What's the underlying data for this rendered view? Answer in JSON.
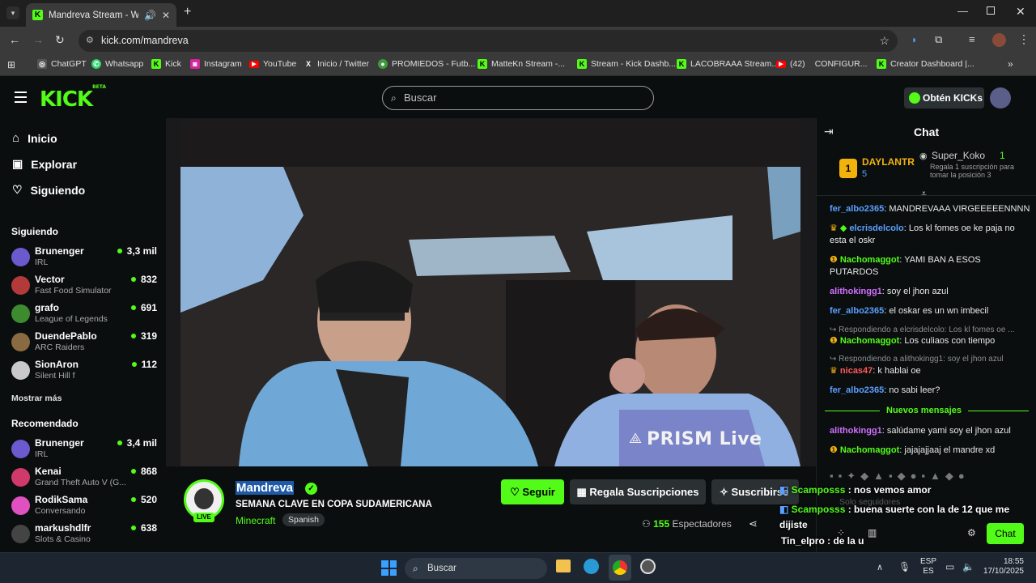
{
  "browser": {
    "tab_title": "Mandreva Stream - Watch",
    "url": "kick.com/mandreva",
    "bookmarks": [
      "ChatGPT",
      "Whatsapp",
      "Kick",
      "Instagram",
      "YouTube",
      "Inicio / Twitter",
      "PROMIEDOS - Futb...",
      "MatteKn Stream -...",
      "Stream - Kick Dashb...",
      "LACOBRAAA Stream...",
      "(42)",
      "CONFIGUR...",
      "Creator Dashboard |..."
    ]
  },
  "header": {
    "logo": "KICK",
    "logo_beta": "BETA",
    "search_placeholder": "Buscar",
    "get_kicks": "Obtén KICKs"
  },
  "sidebar": {
    "nav": [
      "Inicio",
      "Explorar",
      "Siguiendo"
    ],
    "following_title": "Siguiendo",
    "following": [
      {
        "name": "Brunenger",
        "category": "IRL",
        "viewers": "3,3 mil",
        "color": "#6a5acd"
      },
      {
        "name": "Vector",
        "category": "Fast Food Simulator",
        "viewers": "832",
        "color": "#b33a3a"
      },
      {
        "name": "grafo",
        "category": "League of Legends",
        "viewers": "691",
        "color": "#3d8b2f"
      },
      {
        "name": "DuendePablo",
        "category": "ARC Raiders",
        "viewers": "319",
        "color": "#8a6a40"
      },
      {
        "name": "SionAron",
        "category": "Silent Hill f",
        "viewers": "112",
        "color": "#c9c9c9"
      }
    ],
    "show_more": "Mostrar más",
    "recommended_title": "Recomendado",
    "recommended": [
      {
        "name": "Brunenger",
        "category": "IRL",
        "viewers": "3,4 mil",
        "color": "#6a5acd"
      },
      {
        "name": "Kenai",
        "category": "Grand Theft Auto V (G...",
        "viewers": "868",
        "color": "#d03a6a"
      },
      {
        "name": "RodikSama",
        "category": "Conversando",
        "viewers": "520",
        "color": "#e050c0"
      },
      {
        "name": "markushdlfr",
        "category": "Slots & Casino",
        "viewers": "638",
        "color": "#444"
      }
    ]
  },
  "video": {
    "watermark": "PRISM Live"
  },
  "stream": {
    "channel": "Mandreva",
    "title": "SEMANA CLAVE EN COPA SUDAMERICANA",
    "category": "Minecraft",
    "language": "Spanish",
    "live": "LIVE",
    "follow": "Seguir",
    "gift_subs": "Regala Suscripciones",
    "subscribe": "Suscribirse",
    "viewers": "155",
    "viewers_label": "Espectadores"
  },
  "chat": {
    "title": "Chat",
    "top_gifter": {
      "name": "DAYLANTR",
      "count": "5"
    },
    "second_gifter": {
      "name": "Super_Koko",
      "count": "1",
      "note": "Regala 1 suscripción para tomar la posición 3"
    },
    "new_messages": "Nuevos mensajes",
    "messages": [
      {
        "user": "fer_albo2365",
        "color": "#5aa0ff",
        "text": "MANDREVAAA VIRGEEEEENNNN"
      },
      {
        "user": "elcrisdelcolo",
        "color": "#5aa0ff",
        "text": "Los kl fomes oe ke paja no esta el oskr"
      },
      {
        "user": "Nachomaggot",
        "color": "#53fc18",
        "text": "YAMI BAN A ESOS PUTARDOS"
      },
      {
        "user": "alithokingg1",
        "color": "#d070ff",
        "text": "soy el jhon azul"
      },
      {
        "user": "fer_albo2365",
        "color": "#5aa0ff",
        "text": "el oskar es un wn imbecil"
      },
      {
        "user": "Nachomaggot",
        "color": "#53fc18",
        "text": "Los culiaos con tiempo",
        "reply": "Respondiendo a elcrisdelcolo: Los kl fomes oe ..."
      },
      {
        "user": "nicas47",
        "color": "#ff5a5a",
        "text": "k hablai oe",
        "reply": "Respondiendo a alithokingg1: soy el jhon azul"
      },
      {
        "user": "fer_albo2365",
        "color": "#5aa0ff",
        "text": "no sabi leer?"
      },
      {
        "user": "alithokingg1",
        "color": "#d070ff",
        "text": "salúdame yami soy el jhon azul"
      },
      {
        "user": "Nachomaggot",
        "color": "#53fc18",
        "text": "jajajajjaaj el mandre xd"
      }
    ],
    "overlay": [
      {
        "user": "Scamposss",
        "text": "nos vemos amor"
      },
      {
        "user": "Scamposss",
        "text": "buena suerte con la de 12 que me dijiste"
      },
      {
        "user": "Tin_elpro",
        "text": "de la u"
      }
    ],
    "faded_placeholder": "Solo seguidores",
    "send": "Chat"
  },
  "taskbar": {
    "search": "Buscar",
    "lang": "ESP",
    "lang2": "ES",
    "time": "18:55",
    "date": "17/10/2025"
  }
}
